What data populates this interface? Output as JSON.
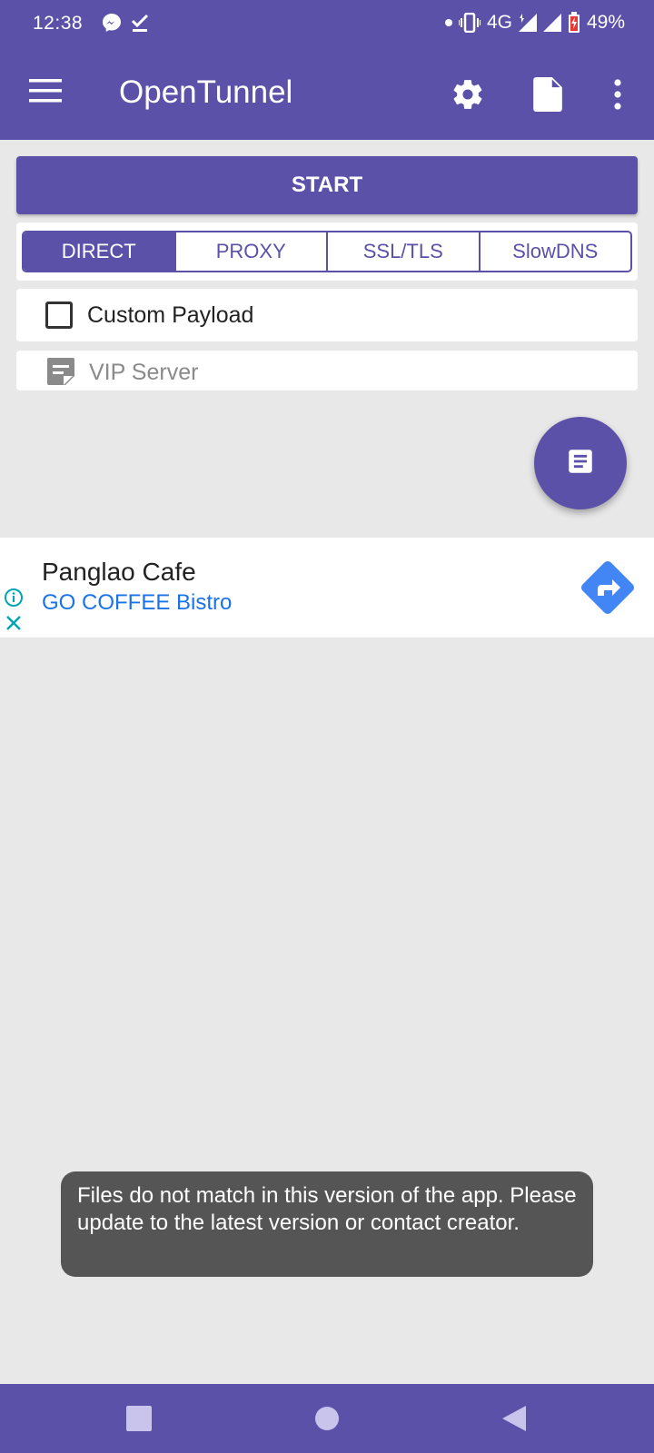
{
  "status_bar": {
    "time": "12:38",
    "network": "4G",
    "battery": "49%",
    "icons": [
      "messenger-icon",
      "download-done-icon",
      "dot-icon",
      "vibrate-icon",
      "signal-icon",
      "signal-icon",
      "battery-charging-icon"
    ]
  },
  "app_bar": {
    "title": "OpenTunnel",
    "icons": [
      "menu-icon",
      "settings-icon",
      "file-icon",
      "more-vert-icon"
    ]
  },
  "start_button": {
    "label": "START"
  },
  "tabs": [
    {
      "label": "DIRECT",
      "active": true
    },
    {
      "label": "PROXY",
      "active": false
    },
    {
      "label": "SSL/TLS",
      "active": false
    },
    {
      "label": "SlowDNS",
      "active": false
    }
  ],
  "payload": {
    "label": "Custom Payload",
    "checked": false
  },
  "server": {
    "label": "VIP Server",
    "icon": "note-icon"
  },
  "fab": {
    "icon": "log-document-icon"
  },
  "ad": {
    "title": "Panglao Cafe",
    "subtitle": "GO COFFEE Bistro",
    "icons": [
      "ad-info-icon",
      "ad-close-icon",
      "directions-icon"
    ]
  },
  "toast": {
    "message": "Files do not match in this version of the app. Please update to the latest version or contact creator."
  },
  "nav_bar": {
    "icons": [
      "recents-icon",
      "home-icon",
      "back-icon"
    ]
  },
  "colors": {
    "primary": "#5b51a8",
    "background": "#e8e8e8",
    "ad_link": "#1a73e8",
    "toast_bg": "#555555"
  }
}
